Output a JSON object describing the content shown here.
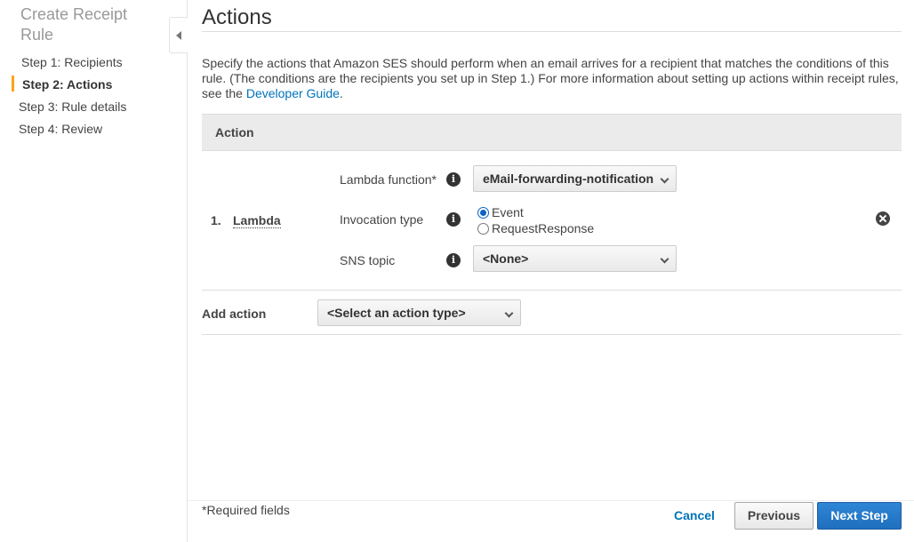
{
  "sidebar": {
    "title": "Create Receipt Rule",
    "steps": [
      {
        "label": "Step 1: Recipients"
      },
      {
        "label": "Step 2: Actions",
        "active": true
      },
      {
        "label": "Step 3: Rule details"
      },
      {
        "label": "Step 4: Review"
      }
    ]
  },
  "main": {
    "title": "Actions",
    "description_pre": "Specify the actions that Amazon SES should perform when an email arrives for a recipient that matches the conditions of this rule. (The conditions are the recipients you set up in Step 1.) For more information about setting up actions within receipt rules, see the ",
    "description_link": "Developer Guide",
    "description_post": ".",
    "table_header": "Action",
    "action": {
      "number": "1.",
      "name": "Lambda",
      "lambda_label": "Lambda function*",
      "lambda_value": "eMail-forwarding-notification",
      "invocation_label": "Invocation type",
      "invocation_options": [
        "Event",
        "RequestResponse"
      ],
      "invocation_selected": "Event",
      "sns_label": "SNS topic",
      "sns_value": "<None>"
    },
    "add_action_label": "Add action",
    "add_action_placeholder": "<Select an action type>"
  },
  "footer": {
    "required_note": "*Required fields",
    "cancel": "Cancel",
    "previous": "Previous",
    "next": "Next Step"
  },
  "colors": {
    "accent_step": "#f7a51c",
    "link": "#0073bb",
    "primary_button": "#1f6fbe"
  }
}
